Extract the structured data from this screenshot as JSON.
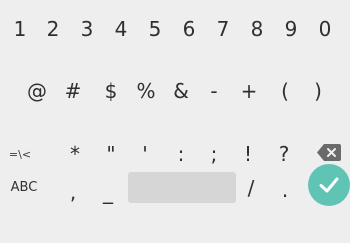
{
  "keyboard": {
    "row1": [
      "1",
      "2",
      "3",
      "4",
      "5",
      "6",
      "7",
      "8",
      "9",
      "0"
    ],
    "row2": [
      "@",
      "#",
      "$",
      "%",
      "&",
      "-",
      "+",
      "(",
      ")"
    ],
    "row3": [
      "=\\<",
      "*",
      "\"",
      "'",
      ":",
      ";",
      "!",
      "?"
    ],
    "row4": [
      "ABC",
      ",",
      "_",
      "/",
      "."
    ],
    "icons": {
      "backspace": "backspace-icon",
      "enter": "checkmark-icon"
    },
    "colors": {
      "background": "#eeeeee",
      "key_text": "#2f2f2f",
      "spacebar": "#d6d6d6",
      "backspace": "#6a6a6a",
      "enter": "#5fc4b4"
    }
  }
}
